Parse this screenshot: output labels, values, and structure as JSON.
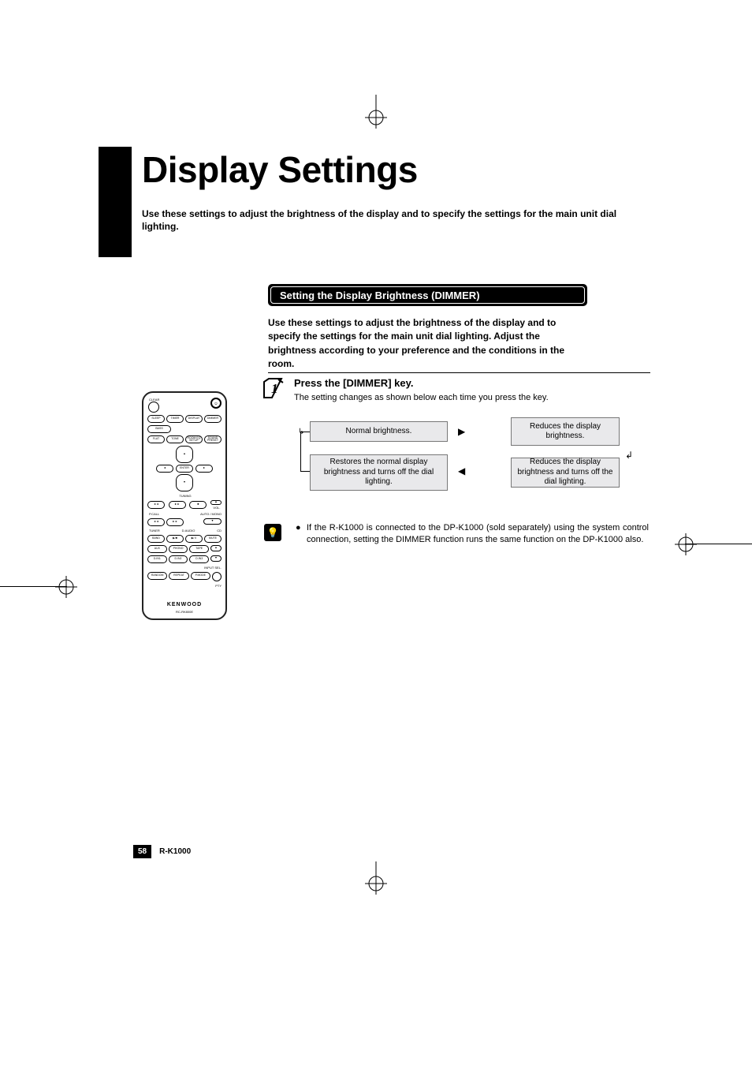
{
  "header": {
    "title": "Display Settings",
    "intro": "Use these settings to adjust the brightness of the display and to specify the settings for the main unit dial lighting."
  },
  "section": {
    "bar_title": "Setting the Display Brightness (DIMMER)",
    "intro": "Use these settings to adjust the brightness of the display and to specify the settings for the main unit dial lighting. Adjust the brightness according to your preference and the conditions in the room."
  },
  "step": {
    "num_glyph": "1",
    "heading": "Press the [DIMMER] key.",
    "sub": "The setting changes as shown below each time you press the key.",
    "flow": {
      "box1": "Normal brightness.",
      "box2": "Reduces the display brightness.",
      "box3": "Restores the normal display brightness and turns off the dial lighting.",
      "box4": "Reduces the display brightness and turns off the dial lighting."
    }
  },
  "note": {
    "bullet": "●",
    "text": "If the R-K1000 is connected to the DP-K1000 (sold separately) using the system control connection, setting the DIMMER function runs the same function on the DP-K1000 also."
  },
  "remote": {
    "clear_label": "CLEAR",
    "row1": [
      "SLEEP",
      "TIMER",
      "DISPLAY",
      "DIMMER"
    ],
    "bass": "BASS",
    "row2": [
      "FLAT",
      "TONE",
      "ROOM EQ SETUP",
      "SOUND PRESET"
    ],
    "enter": "ENTER",
    "tuning": "TUNING",
    "pcall": "P.CALL",
    "automono": "AUTO / MONO",
    "vol": "VOL.",
    "row5_labels": [
      "TUNER",
      "D.AUDIO",
      "CD"
    ],
    "row5": [
      "BAND",
      "▶/■",
      "▶/ II",
      "MUTE"
    ],
    "row6": [
      "AUX",
      "PHONO",
      "TAPE"
    ],
    "row7": [
      "D.IN1",
      "D.IN2",
      "D.IN3"
    ],
    "inputsel": "INPUT SEL.",
    "row8": [
      "RANDOM",
      "REPEAT",
      "P.MODE"
    ],
    "ptylabel": "PTY",
    "brand": "KENWOOD",
    "model": "RC-RK800E",
    "icons": {
      "power": "⏻",
      "eject": "▲",
      "down": "▼",
      "left": "◄",
      "right": "►",
      "rew": "◄◄",
      "fwd": "►►",
      "stop": "■",
      "up_small": "▲",
      "down_small": "▼"
    }
  },
  "footer": {
    "page": "58",
    "model": "R-K1000"
  }
}
